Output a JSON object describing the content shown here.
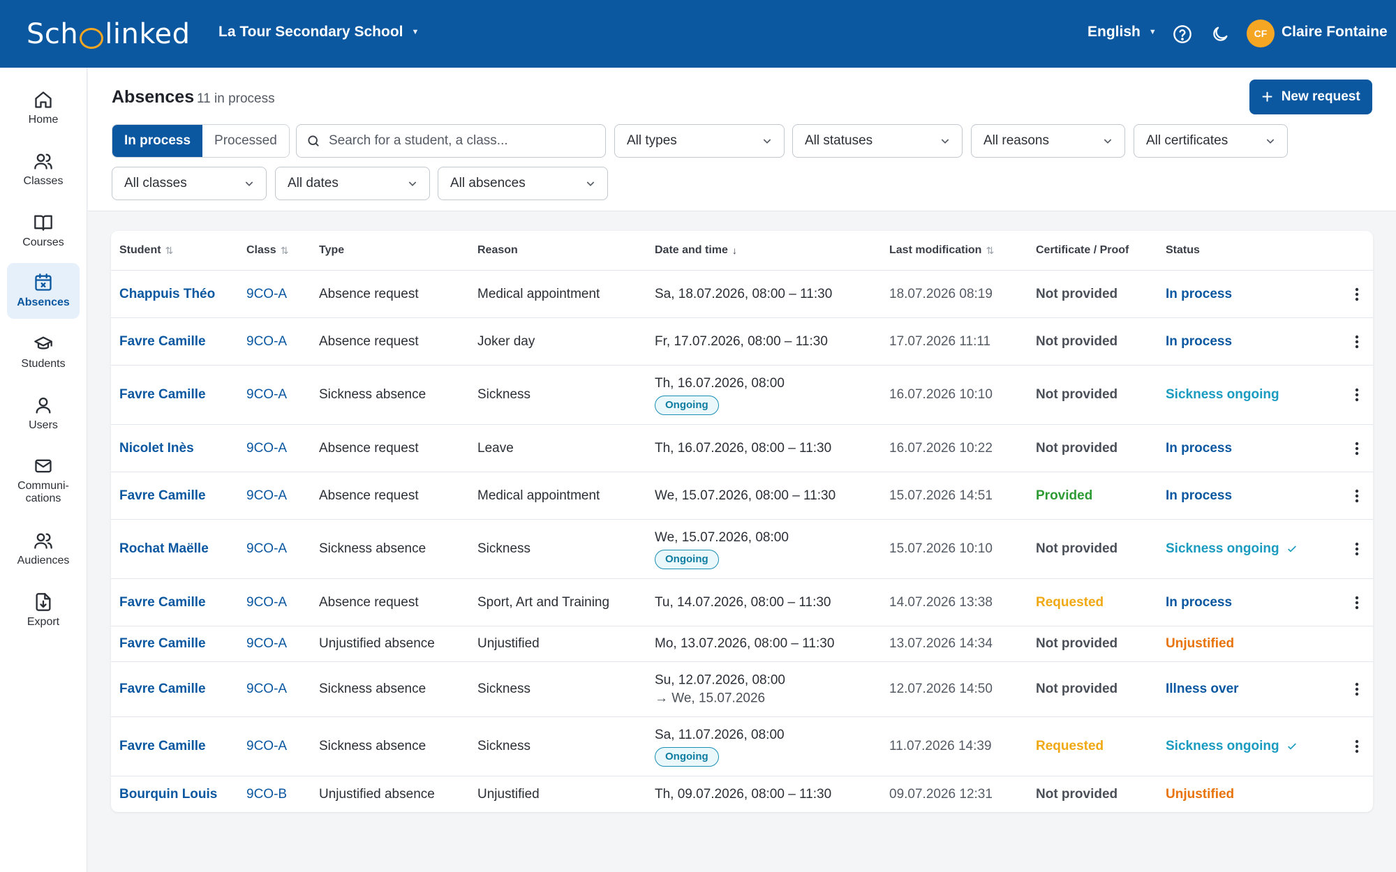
{
  "app": {
    "logo_text_a": "Sch",
    "logo_text_b": "linked",
    "school": "La Tour Secondary School",
    "language": "English",
    "user_initials": "CF",
    "user_name": "Claire Fontaine"
  },
  "sidebar": {
    "items": [
      {
        "label": "Home",
        "icon": "home-icon"
      },
      {
        "label": "Classes",
        "icon": "people-icon"
      },
      {
        "label": "Courses",
        "icon": "book-icon"
      },
      {
        "label": "Absences",
        "icon": "calendar-x-icon",
        "active": true
      },
      {
        "label": "Students",
        "icon": "graduation-cap-icon"
      },
      {
        "label": "Users",
        "icon": "user-icon"
      },
      {
        "label": "Communi-\ncations",
        "icon": "mail-icon"
      },
      {
        "label": "Audiences",
        "icon": "group-icon"
      },
      {
        "label": "Export",
        "icon": "file-export-icon"
      }
    ]
  },
  "header": {
    "title": "Absences",
    "count": "11 in process",
    "new_request": "New request",
    "tabs": [
      "In process",
      "Processed"
    ],
    "search_placeholder": "Search for a student, a class...",
    "filters": [
      "All types",
      "All statuses",
      "All reasons",
      "All certificates",
      "All classes",
      "All dates",
      "All absences"
    ]
  },
  "table": {
    "columns": [
      "Student",
      "Class",
      "Type",
      "Reason",
      "Date and time",
      "Last modification",
      "Certificate / Proof",
      "Status"
    ],
    "rows": [
      {
        "student": "Chappuis Théo",
        "class": "9CO-A",
        "type": "Absence request",
        "reason": "Medical appointment",
        "date": "Sa, 18.07.2026, 08:00 – 11:30",
        "date2": "",
        "pill": "",
        "modified": "18.07.2026 08:19",
        "certificate": "Not provided",
        "status": "In process",
        "check": false,
        "menu": true
      },
      {
        "student": "Favre Camille",
        "class": "9CO-A",
        "type": "Absence request",
        "reason": "Joker day",
        "date": "Fr, 17.07.2026, 08:00 – 11:30",
        "date2": "",
        "pill": "",
        "modified": "17.07.2026 11:11",
        "certificate": "Not provided",
        "status": "In process",
        "check": false,
        "menu": true
      },
      {
        "student": "Favre Camille",
        "class": "9CO-A",
        "type": "Sickness absence",
        "reason": "Sickness",
        "date": "Th, 16.07.2026, 08:00",
        "date2": "",
        "pill": "Ongoing",
        "modified": "16.07.2026 10:10",
        "certificate": "Not provided",
        "status": "Sickness ongoing",
        "check": false,
        "menu": true
      },
      {
        "student": "Nicolet Inès",
        "class": "9CO-A",
        "type": "Absence request",
        "reason": "Leave",
        "date": "Th, 16.07.2026, 08:00 – 11:30",
        "date2": "",
        "pill": "",
        "modified": "16.07.2026 10:22",
        "certificate": "Not provided",
        "status": "In process",
        "check": false,
        "menu": true
      },
      {
        "student": "Favre Camille",
        "class": "9CO-A",
        "type": "Absence request",
        "reason": "Medical appointment",
        "date": "We, 15.07.2026, 08:00 – 11:30",
        "date2": "",
        "pill": "",
        "modified": "15.07.2026 14:51",
        "certificate": "Provided",
        "status": "In process",
        "check": false,
        "menu": true
      },
      {
        "student": "Rochat Maëlle",
        "class": "9CO-A",
        "type": "Sickness absence",
        "reason": "Sickness",
        "date": "We, 15.07.2026, 08:00",
        "date2": "",
        "pill": "Ongoing",
        "modified": "15.07.2026 10:10",
        "certificate": "Not provided",
        "status": "Sickness ongoing",
        "check": true,
        "menu": true
      },
      {
        "student": "Favre Camille",
        "class": "9CO-A",
        "type": "Absence request",
        "reason": "Sport, Art and Training",
        "date": "Tu, 14.07.2026, 08:00 – 11:30",
        "date2": "",
        "pill": "",
        "modified": "14.07.2026 13:38",
        "certificate": "Requested",
        "status": "In process",
        "check": false,
        "menu": true
      },
      {
        "student": "Favre Camille",
        "class": "9CO-A",
        "type": "Unjustified absence",
        "reason": "Unjustified",
        "date": "Mo, 13.07.2026, 08:00 – 11:30",
        "date2": "",
        "pill": "",
        "modified": "13.07.2026 14:34",
        "certificate": "Not provided",
        "status": "Unjustified",
        "check": false,
        "menu": false
      },
      {
        "student": "Favre Camille",
        "class": "9CO-A",
        "type": "Sickness absence",
        "reason": "Sickness",
        "date": "Su, 12.07.2026, 08:00",
        "date2": "→ We, 15.07.2026",
        "pill": "",
        "modified": "12.07.2026 14:50",
        "certificate": "Not provided",
        "status": "Illness over",
        "check": false,
        "menu": true
      },
      {
        "student": "Favre Camille",
        "class": "9CO-A",
        "type": "Sickness absence",
        "reason": "Sickness",
        "date": "Sa, 11.07.2026, 08:00",
        "date2": "",
        "pill": "Ongoing",
        "modified": "11.07.2026 14:39",
        "certificate": "Requested",
        "status": "Sickness ongoing",
        "check": true,
        "menu": true
      },
      {
        "student": "Bourquin Louis",
        "class": "9CO-B",
        "type": "Unjustified absence",
        "reason": "Unjustified",
        "date": "Th, 09.07.2026, 08:00 – 11:30",
        "date2": "",
        "pill": "",
        "modified": "09.07.2026 12:31",
        "certificate": "Not provided",
        "status": "Unjustified",
        "check": false,
        "menu": false
      }
    ]
  },
  "colors": {
    "brand": "#0b58a1",
    "accent_orange": "#f5a623",
    "status_blue": "#0b58a1",
    "status_teal": "#1a9bbf",
    "status_orange": "#e8730d",
    "cert_green": "#2e9b34",
    "cert_amber": "#f0a814"
  }
}
